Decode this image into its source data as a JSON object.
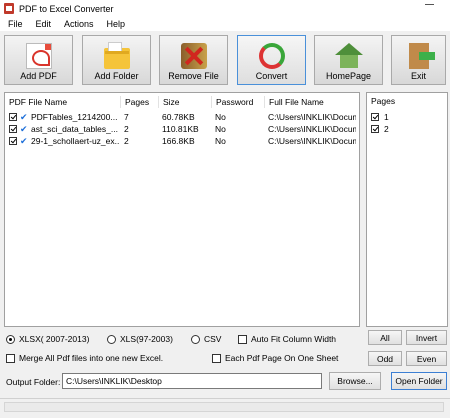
{
  "window": {
    "title": "PDF to Excel Converter"
  },
  "menu": [
    "File",
    "Edit",
    "Actions",
    "Help"
  ],
  "toolbar": [
    {
      "label": "Add PDF",
      "icon": "pdf-file-icon"
    },
    {
      "label": "Add Folder",
      "icon": "folder-icon"
    },
    {
      "label": "Remove File",
      "icon": "remove-icon"
    },
    {
      "label": "Convert",
      "icon": "convert-icon"
    },
    {
      "label": "HomePage",
      "icon": "home-icon"
    },
    {
      "label": "Exit",
      "icon": "exit-icon"
    }
  ],
  "file_table": {
    "columns": [
      "PDF File Name",
      "Pages",
      "Size",
      "Password",
      "Full File Name"
    ],
    "rows": [
      {
        "name": "PDFTables_1214200...",
        "pages": "7",
        "size": "60.78KB",
        "password": "No",
        "full": "C:\\Users\\INKLIK\\Docum"
      },
      {
        "name": "ast_sci_data_tables_...",
        "pages": "2",
        "size": "110.81KB",
        "password": "No",
        "full": "C:\\Users\\INKLIK\\Docum"
      },
      {
        "name": "29-1_schollaert-uz_ex...",
        "pages": "2",
        "size": "166.8KB",
        "password": "No",
        "full": "C:\\Users\\INKLIK\\Docum"
      }
    ]
  },
  "pages_panel": {
    "header": "Pages",
    "items": [
      "1",
      "2"
    ]
  },
  "options": {
    "format_xlsx": "XLSX( 2007-2013)",
    "format_xls": "XLS(97-2003)",
    "format_csv": "CSV",
    "auto_fit": "Auto Fit Column Width",
    "merge_all": "Merge All Pdf files into one new Excel.",
    "each_page": "Each Pdf Page On One Sheet"
  },
  "page_buttons": {
    "all": "All",
    "invert": "Invert",
    "odd": "Odd",
    "even": "Even"
  },
  "output": {
    "label": "Output Folder:",
    "value": "C:\\Users\\INKLIK\\Desktop",
    "browse": "Browse...",
    "open": "Open Folder"
  }
}
